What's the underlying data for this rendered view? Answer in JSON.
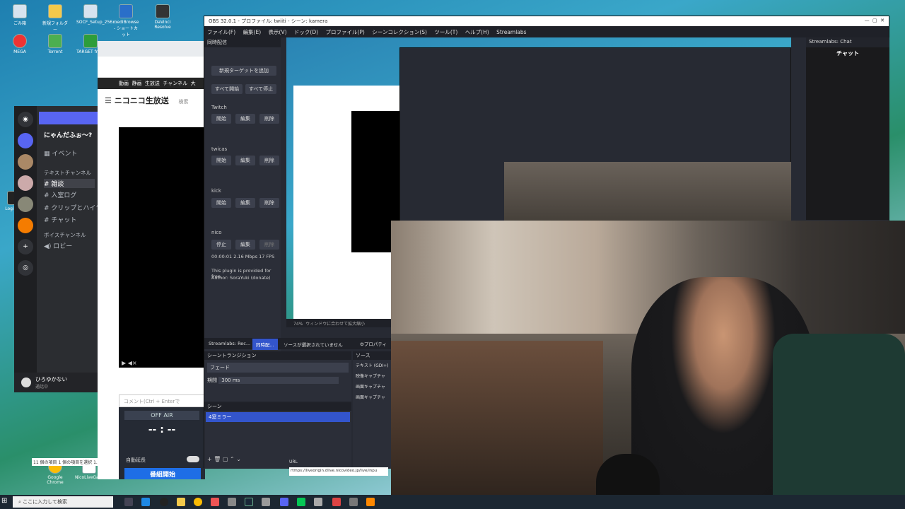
{
  "desktop": {
    "icons": [
      {
        "label": "ごみ箱"
      },
      {
        "label": "新規フォルダー"
      },
      {
        "label": "SOCF_Setup_256..."
      },
      {
        "label": "mediBrowse - ショートカット"
      },
      {
        "label": "DaVinci Resolve"
      },
      {
        "label": "MEGA"
      },
      {
        "label": "Torrent"
      },
      {
        "label": "TARGET front"
      },
      {
        "label": "Logitech"
      },
      {
        "label": "Ashampoo"
      },
      {
        "label": "Google Chrome"
      },
      {
        "label": "NicoLiveGarden"
      }
    ],
    "explorer_status": "11 個の項目   1 個の項目を選択 1.00 KB"
  },
  "discord": {
    "server_name": "にゃんだふぉ～?",
    "events_label": "イベント",
    "text_channels_header": "テキストチャンネル",
    "text_channels": [
      "雑談",
      "入室ログ",
      "クリップとハイライト",
      "チャット"
    ],
    "voice_header": "ボイスチャンネル",
    "voice_channels": [
      "ロビー"
    ],
    "user_name": "ひろゆかない",
    "user_status": "通話中"
  },
  "browser": {
    "nico_nav": [
      "動画",
      "静画",
      "生放送",
      "チャンネル",
      "大"
    ],
    "logo": "ニコニコ生放送",
    "search_placeholder": "検索",
    "comment_placeholder": "コメント(Ctrl + Enterで",
    "onair_label": "OFF AIR",
    "timer": "-- : --",
    "auto_extend": "自動延長",
    "start_button": "番組開始"
  },
  "obs": {
    "title": "OBS 32.0.1 - プロファイル: twiiti - シーン: kamera",
    "menu": [
      "ファイル(F)",
      "編集(E)",
      "表示(V)",
      "ドック(D)",
      "プロファイル(P)",
      "シーンコレクション(S)",
      "ツール(T)",
      "ヘルプ(H)",
      "Streamlabs"
    ],
    "multistream": {
      "header": "同時配信",
      "add_target": "新規ターゲットを追加",
      "start_all": "すべて開始",
      "stop_all": "すべて停止",
      "targets": [
        {
          "name": "Twitch",
          "start": "開始",
          "edit": "編集",
          "delete": "削除"
        },
        {
          "name": "twicas",
          "start": "開始",
          "edit": "編集",
          "delete": "削除"
        },
        {
          "name": "kick",
          "start": "開始",
          "edit": "編集",
          "delete": "削除"
        },
        {
          "name": "nico",
          "start": "停止",
          "edit": "編集",
          "delete": "削除"
        }
      ],
      "stats": "00:00:01  2.16 Mbps  17 FPS",
      "notice": "This plugin is provided for free.",
      "author": "Author: SoraYuki (donate)"
    },
    "chat": {
      "header": "Streamlabs: Chat",
      "title": "チャット"
    },
    "preview_zoom": "74%",
    "preview_status": "ウィンドウに合わせて拡大縮小",
    "tabs": [
      "Streamlabs: Rec...",
      "同時配..."
    ],
    "no_source": "ソースが選択されていません",
    "properties": "プロパティ",
    "transition": {
      "header": "シーントランジション",
      "type": "フェード",
      "duration_label": "期間",
      "duration": "300 ms"
    },
    "scenes": {
      "header": "シーン",
      "items": [
        "4窓ミラー"
      ]
    },
    "sources": {
      "header": "ソース",
      "items": [
        "テキスト (GDI+)",
        "映像キャプチャ",
        "画面キャプチャ",
        "画面キャプチャ"
      ]
    },
    "url_label": "URL",
    "url": "rtmps://liveorigin.dlive.nicovideo.jp/live/inpu"
  },
  "taskbar": {
    "search_placeholder": "ここに入力して検索"
  },
  "colors": {
    "obs_bg": "#272a33",
    "accent": "#3355cc",
    "discord_blurple": "#5865f2"
  }
}
